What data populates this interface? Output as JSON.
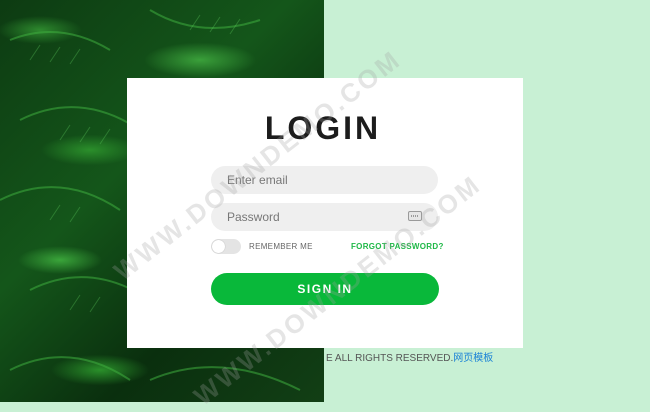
{
  "login": {
    "title": "LOGIN",
    "email_placeholder": "Enter email",
    "password_placeholder": "Password",
    "remember_label": "REMEMBER ME",
    "forgot_label": "FORGOT PASSWORD?",
    "signin_label": "SIGN IN"
  },
  "footer": {
    "text": "E ALL RIGHTS RESERVED.",
    "link": "网页模板"
  },
  "watermark": {
    "line1": "WWW.DOWNDEMO.COM",
    "line2": "WWW.DOWNDEMO.COM"
  },
  "colors": {
    "accent": "#09b83a",
    "background": "#c8f0d4",
    "foliage": "#14561a"
  }
}
